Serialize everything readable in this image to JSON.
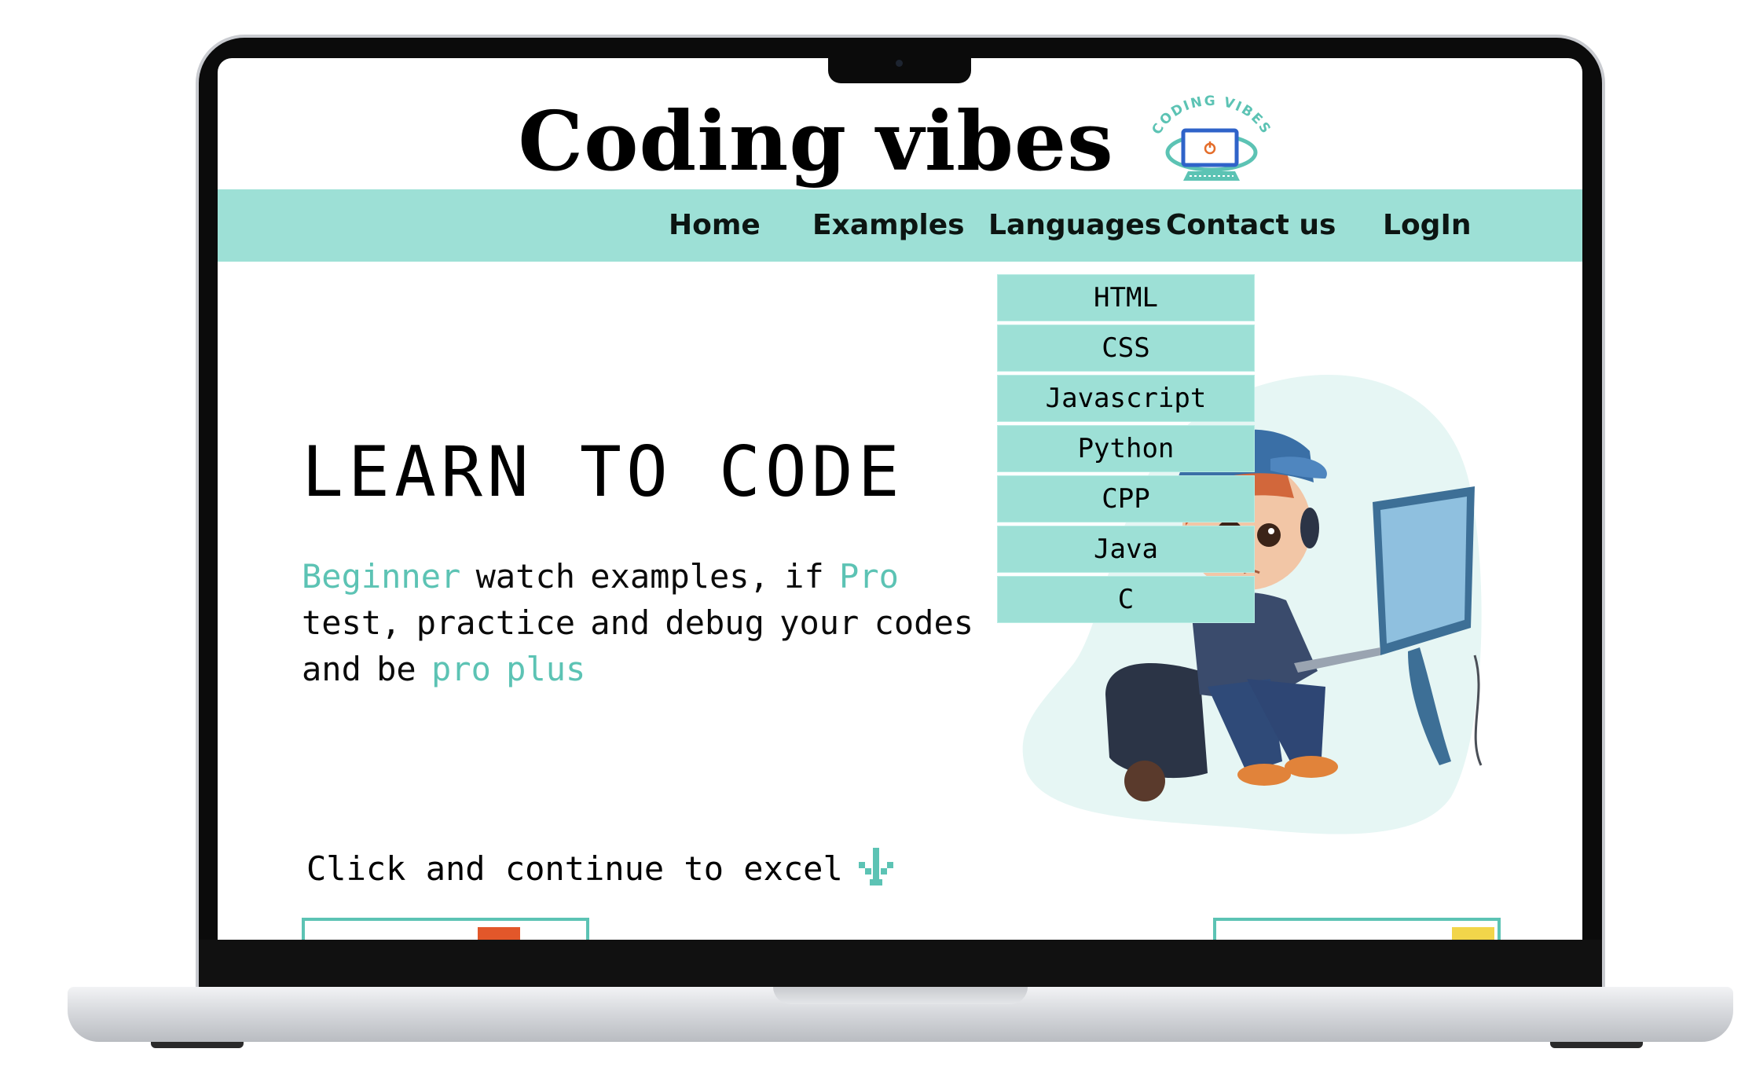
{
  "brand": {
    "title": "Coding vibes",
    "logo_text_top": "CODING VIBES",
    "logo_icon": "monitor-power-icon"
  },
  "nav": {
    "items": [
      "Home",
      "Examples",
      "Languages",
      "Contact us",
      "LogIn"
    ]
  },
  "languages_menu": {
    "items": [
      "HTML",
      "CSS",
      "Javascript",
      "Python",
      "CPP",
      "Java",
      "C"
    ]
  },
  "hero": {
    "title": "LEARN TO CODE",
    "segments": {
      "beginner": "Beginner",
      "part1": " watch examples, if ",
      "pro": "Pro",
      "part2": " test, practice and debug your codes and be ",
      "pro_plus": "pro plus"
    }
  },
  "cta": {
    "label": "Click and continue to excel",
    "icon": "arrow-down-icon"
  },
  "colors": {
    "accent": "#5cc3b4",
    "nav_bg": "#9de0d6",
    "card_chip_left": "#e2572a",
    "card_chip_right": "#f2d54a"
  }
}
